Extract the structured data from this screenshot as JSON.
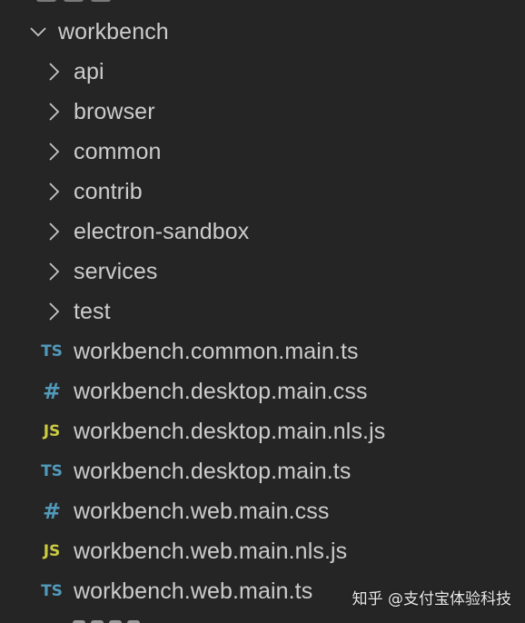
{
  "colors": {
    "background": "#252526",
    "text": "#cccccc",
    "chevron": "#c5c5c5",
    "ts_icon": "#519aba",
    "css_icon": "#519aba",
    "js_icon": "#cbcb41"
  },
  "explorer": {
    "root_folder": {
      "label": "workbench",
      "expanded": true,
      "icon": "chevron-down-icon"
    },
    "folders": [
      {
        "label": "api",
        "icon": "chevron-right-icon"
      },
      {
        "label": "browser",
        "icon": "chevron-right-icon"
      },
      {
        "label": "common",
        "icon": "chevron-right-icon"
      },
      {
        "label": "contrib",
        "icon": "chevron-right-icon"
      },
      {
        "label": "electron-sandbox",
        "icon": "chevron-right-icon"
      },
      {
        "label": "services",
        "icon": "chevron-right-icon"
      },
      {
        "label": "test",
        "icon": "chevron-right-icon"
      }
    ],
    "files": [
      {
        "label": "workbench.common.main.ts",
        "icon_text": "TS",
        "icon": "typescript-file-icon"
      },
      {
        "label": "workbench.desktop.main.css",
        "icon_text": "#",
        "icon": "css-file-icon"
      },
      {
        "label": "workbench.desktop.main.nls.js",
        "icon_text": "JS",
        "icon": "javascript-file-icon"
      },
      {
        "label": "workbench.desktop.main.ts",
        "icon_text": "TS",
        "icon": "typescript-file-icon"
      },
      {
        "label": "workbench.web.main.css",
        "icon_text": "#",
        "icon": "css-file-icon"
      },
      {
        "label": "workbench.web.main.nls.js",
        "icon_text": "JS",
        "icon": "javascript-file-icon"
      },
      {
        "label": "workbench.web.main.ts",
        "icon_text": "TS",
        "icon": "typescript-file-icon"
      }
    ]
  },
  "watermark": {
    "text": "知乎 @支付宝体验科技"
  }
}
